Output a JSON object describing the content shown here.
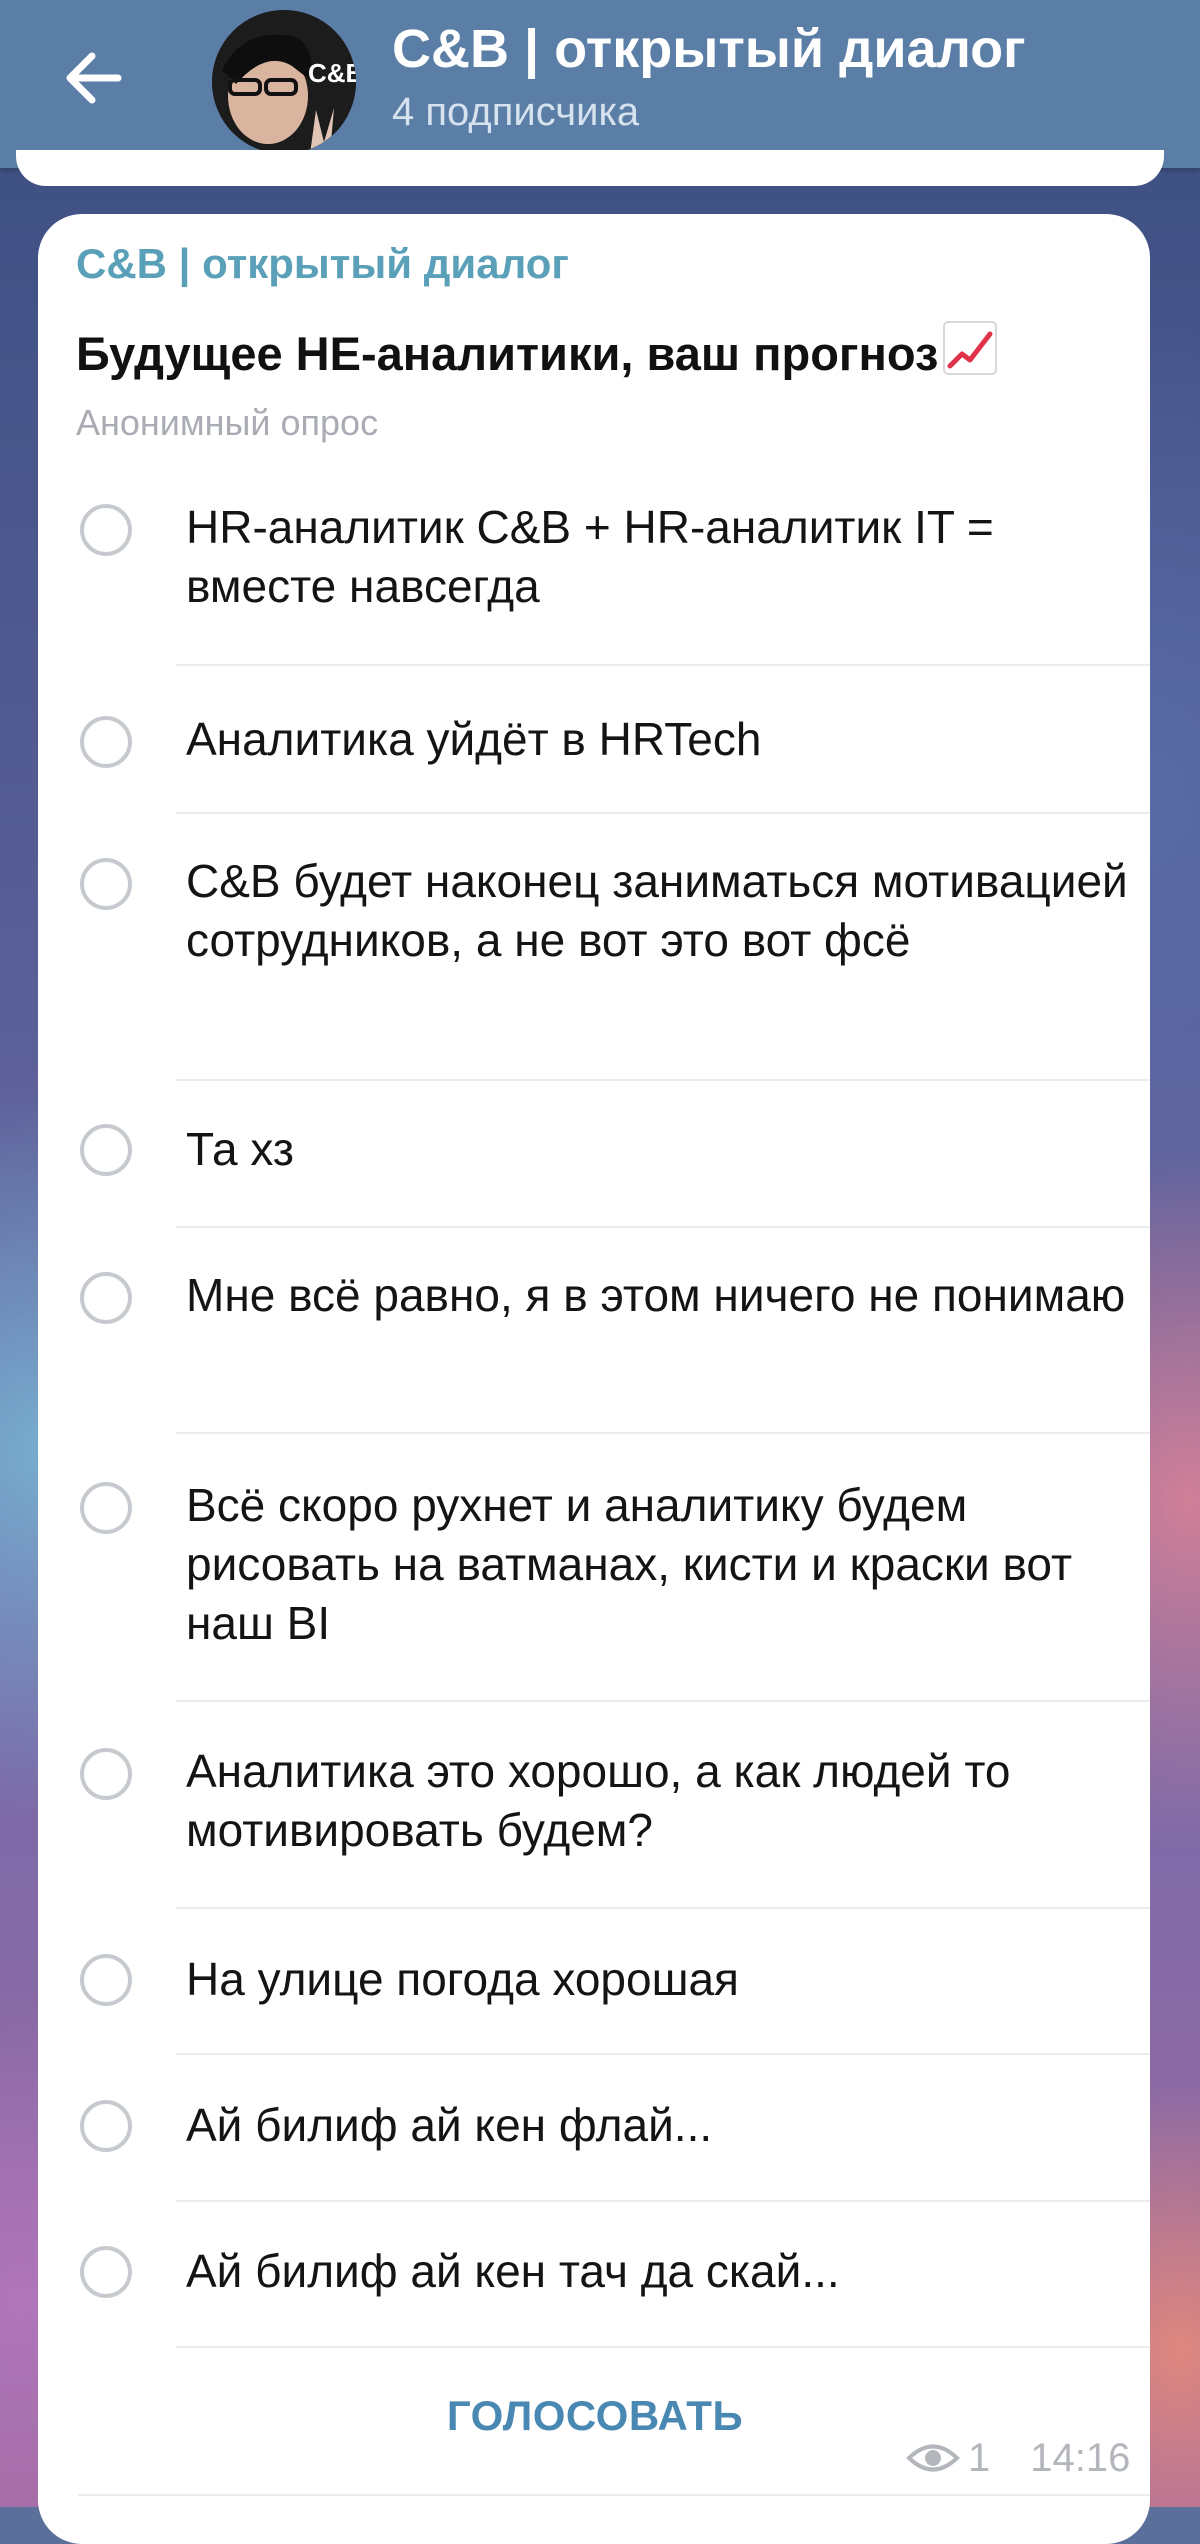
{
  "header": {
    "back_icon": "arrow-left-icon",
    "avatar_label": "C&B",
    "title": "C&B | открытый диалог",
    "subtitle": "4 подписчика"
  },
  "poll": {
    "channel_name": "C&B | открытый диалог",
    "question": "Будущее НЕ-аналитики, ваш прогноз",
    "question_emoji": "chart-increasing-icon",
    "type": "Анонимный опрос",
    "options": [
      {
        "label": "HR-аналитик C&B + HR-аналитик IT = вместе навсегда"
      },
      {
        "label": "Аналитика уйдёт в HRTech"
      },
      {
        "label": "C&B будет наконец заниматься мотивацией сотрудников, а не вот это вот фсё"
      },
      {
        "label": "Та хз"
      },
      {
        "label": "Мне всё равно, я в этом ничего не понимаю"
      },
      {
        "label": "Всё скоро рухнет и аналитику будем рисовать на ватманах, кисти и краски вот наш BI"
      },
      {
        "label": "Аналитика это хорошо, а как людей то мотивировать будем?"
      },
      {
        "label": "На улице погода хорошая"
      },
      {
        "label": "Ай билиф ай кен флай..."
      },
      {
        "label": "Ай билиф ай кен тач да скай..."
      }
    ],
    "vote_button": "ГОЛОСОВАТЬ",
    "views": "1",
    "time": "14:16"
  },
  "colors": {
    "header_bg": "#5b7ea7",
    "channel_name": "#5aa0b8",
    "vote_button": "#4a88b4"
  }
}
